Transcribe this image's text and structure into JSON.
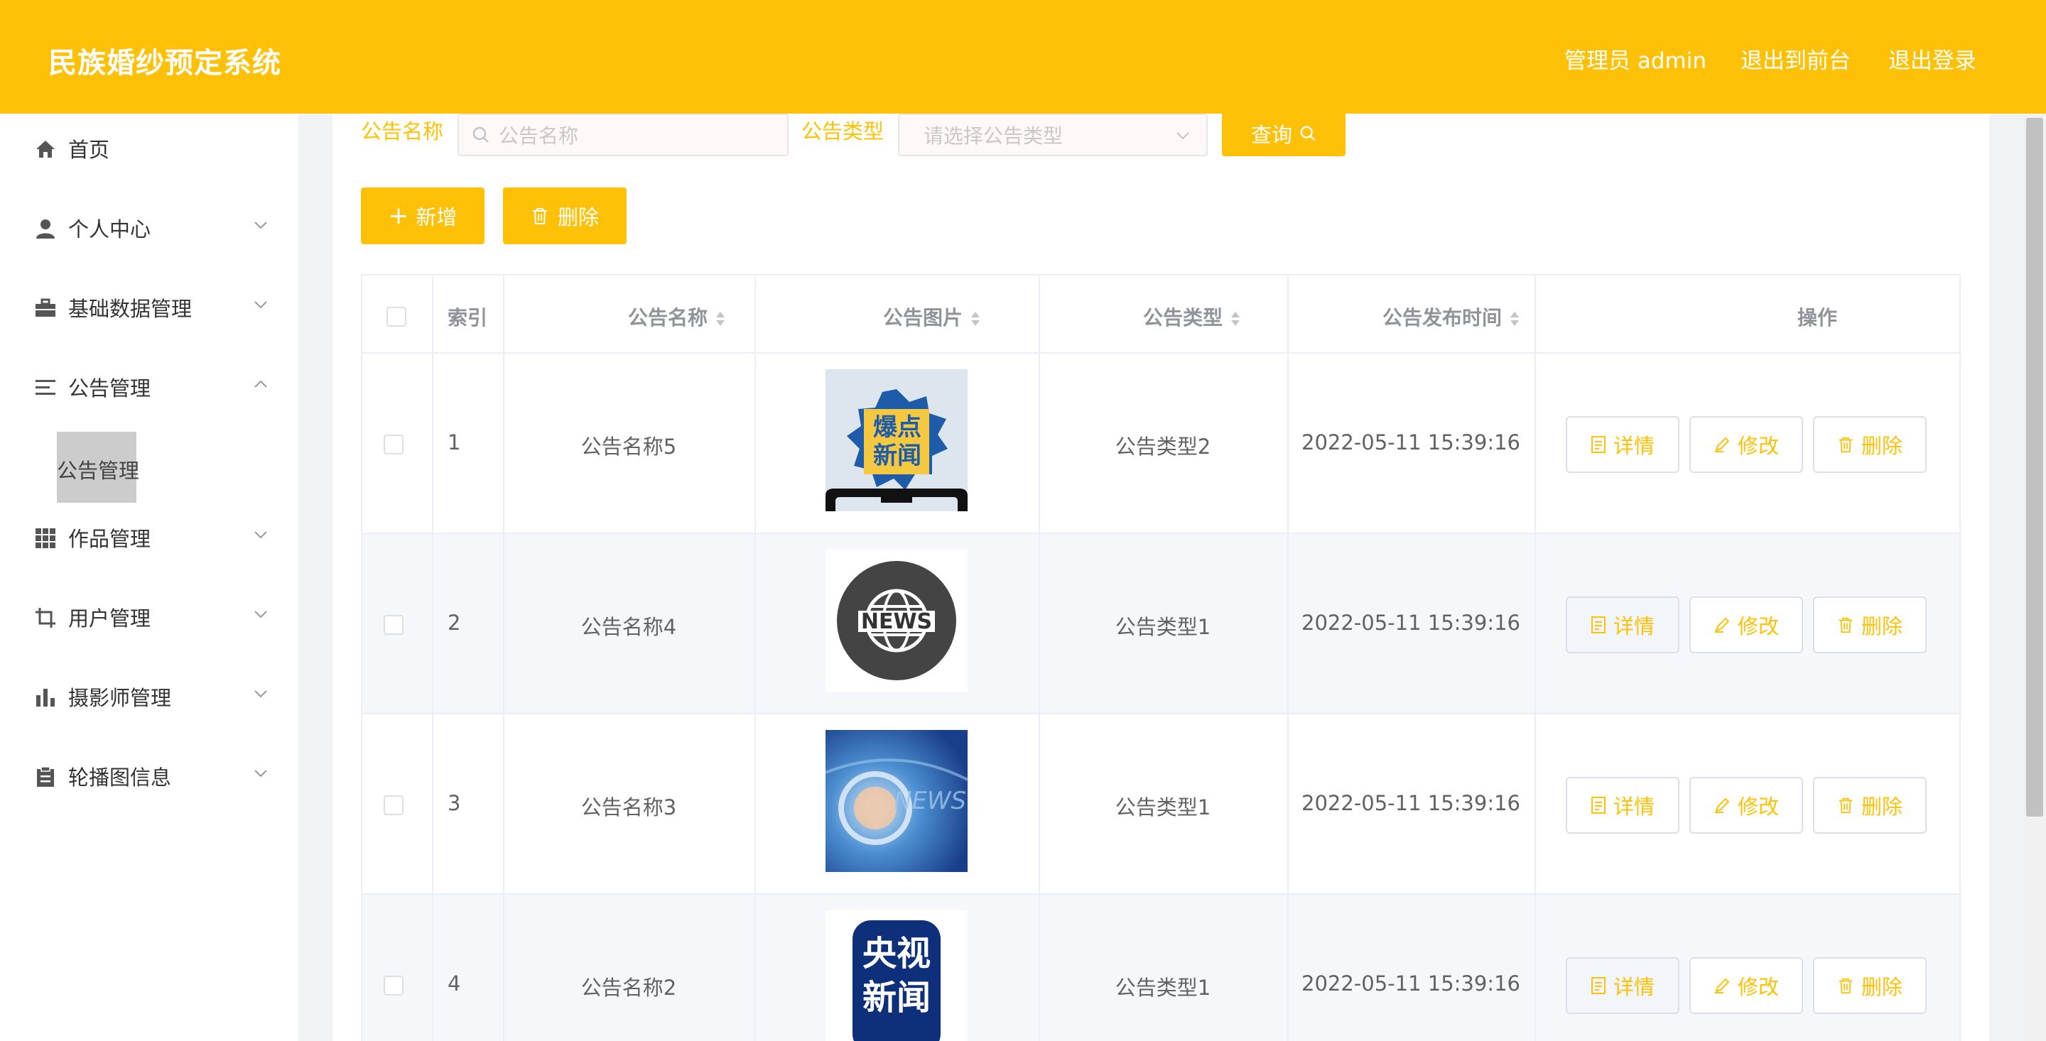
{
  "header": {
    "title": "民族婚纱预定系统",
    "user_label": "管理员 admin",
    "front_link": "退出到前台",
    "logout_link": "退出登录",
    "color": "#ffc107"
  },
  "sidebar": {
    "items": [
      {
        "label": "首页",
        "icon": "home-icon"
      },
      {
        "label": "个人中心",
        "icon": "user-icon"
      },
      {
        "label": "基础数据管理",
        "icon": "briefcase-icon"
      },
      {
        "label": "公告管理",
        "icon": "list-indent-icon",
        "expanded": true
      },
      {
        "label": "作品管理",
        "icon": "grid-icon"
      },
      {
        "label": "用户管理",
        "icon": "crop-icon"
      },
      {
        "label": "摄影师管理",
        "icon": "bar-chart-icon"
      },
      {
        "label": "轮播图信息",
        "icon": "clipboard-icon"
      }
    ],
    "subitem": "公告管理"
  },
  "search": {
    "name_label": "公告名称",
    "name_placeholder": "公告名称",
    "type_label": "公告类型",
    "type_placeholder": "请选择公告类型",
    "query_button": "查询"
  },
  "actions": {
    "add_button": "新增",
    "delete_button": "删除"
  },
  "table": {
    "headers": [
      "索引",
      "公告名称",
      "公告图片",
      "公告类型",
      "公告发布时间",
      "操作"
    ],
    "rows": [
      {
        "index": "1",
        "name": "公告名称5",
        "image": "爆点新闻",
        "type": "公告类型2",
        "time": "2022-05-11 15:39:16"
      },
      {
        "index": "2",
        "name": "公告名称4",
        "image": "NEWS",
        "type": "公告类型1",
        "time": "2022-05-11 15:39:16"
      },
      {
        "index": "3",
        "name": "公告名称3",
        "image": "NEWS",
        "type": "公告类型1",
        "time": "2022-05-11 15:39:16"
      },
      {
        "index": "4",
        "name": "公告名称2",
        "image": "央视新闻",
        "type": "公告类型1",
        "time": "2022-05-11 15:39:16"
      }
    ],
    "op_detail": "详情",
    "op_edit": "修改",
    "op_delete": "删除"
  }
}
